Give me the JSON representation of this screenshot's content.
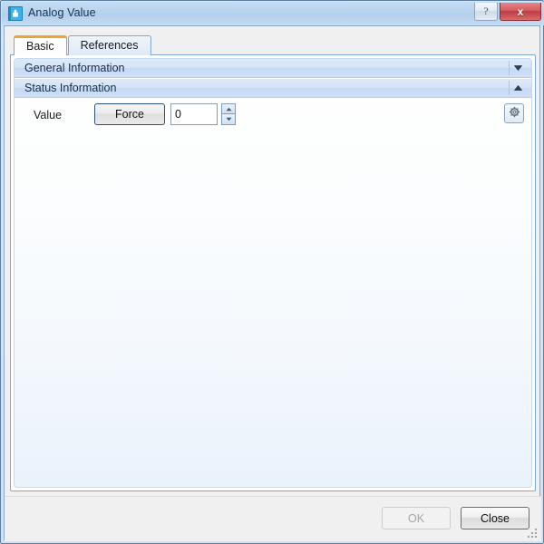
{
  "window": {
    "title": "Analog Value",
    "icon": "analog-value-icon",
    "controls": {
      "help_label": "?",
      "close_label": "x"
    }
  },
  "tabs": [
    {
      "label": "Basic",
      "active": true
    },
    {
      "label": "References",
      "active": false
    }
  ],
  "groups": [
    {
      "label": "General Information",
      "expanded": false,
      "chevron": "chevron-down-icon"
    },
    {
      "label": "Status Information",
      "expanded": true,
      "chevron": "chevron-up-icon"
    }
  ],
  "status_form": {
    "value_label": "Value",
    "force_button_label": "Force",
    "value_field": {
      "value": "0",
      "placeholder": ""
    },
    "spinner": {
      "up": "spinner-up-icon",
      "down": "spinner-down-icon"
    },
    "settings_button": "gear-icon"
  },
  "footer": {
    "ok_label": "OK",
    "ok_enabled": false,
    "close_label": "Close",
    "close_enabled": true,
    "grip": "resize-grip-icon"
  },
  "colors": {
    "titlebar": "#b6d2ed",
    "accent_tab": "#f0a22e",
    "group_header": "#d3e3f8",
    "close_button": "#bd3c40",
    "frame_border": "#5d7fa3"
  }
}
